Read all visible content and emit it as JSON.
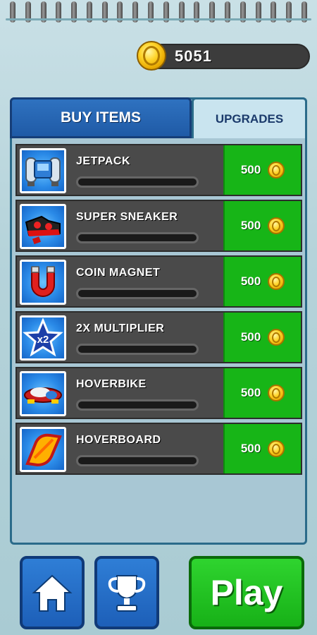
{
  "currency": {
    "amount": "5051",
    "icon": "coin-icon"
  },
  "tabs": [
    {
      "label": "BUY ITEMS",
      "active": true
    },
    {
      "label": "UPGRADES",
      "active": false
    }
  ],
  "items": [
    {
      "name": "JETPACK",
      "icon": "jetpack-icon",
      "price": "500",
      "progress": 0
    },
    {
      "name": "SUPER SNEAKER",
      "icon": "sneaker-icon",
      "price": "500",
      "progress": 0
    },
    {
      "name": "COIN MAGNET",
      "icon": "magnet-icon",
      "price": "500",
      "progress": 0
    },
    {
      "name": "2X MULTIPLIER",
      "icon": "multiplier-star-icon",
      "price": "500",
      "progress": 0,
      "badge": "x2"
    },
    {
      "name": "HOVERBIKE",
      "icon": "hoverbike-icon",
      "price": "500",
      "progress": 0
    },
    {
      "name": "HOVERBOARD",
      "icon": "hoverboard-icon",
      "price": "500",
      "progress": 0
    }
  ],
  "bottom": {
    "home_icon": "home-icon",
    "trophy_icon": "trophy-icon",
    "play_label": "Play"
  },
  "colors": {
    "buy_green": "#17b517",
    "tab_blue": "#1f5aa6",
    "row_dark": "#4a4a4a"
  }
}
